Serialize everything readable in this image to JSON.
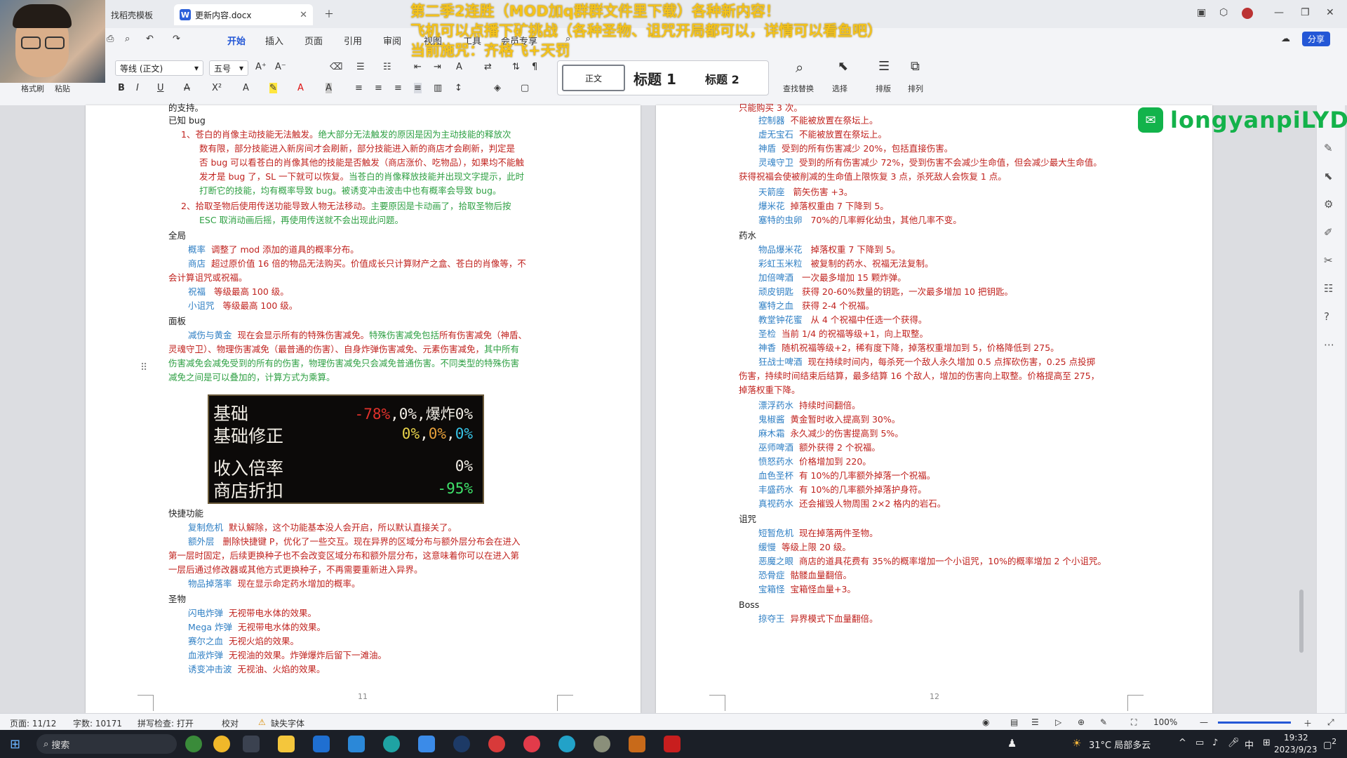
{
  "window": {
    "tabs": [
      {
        "label": "找稻壳模板"
      },
      {
        "label": "更新内容.docx"
      }
    ]
  },
  "ribbon": {
    "tabs": [
      "开始",
      "插入",
      "页面",
      "引用",
      "审阅",
      "视图",
      "工具",
      "会员专享"
    ],
    "share": "分享",
    "format_painter": "格式刷",
    "paste": "粘贴",
    "font": "等线 (正文)",
    "size": "五号",
    "style_normal": "正文",
    "style_h1": "标题 1",
    "style_h2": "标题 2",
    "find_replace": "查找替换",
    "select": "选择",
    "layout": "排版",
    "arrange": "排列"
  },
  "overlay": {
    "line1": "第二季2连胜（MOD加q群群文件里下载）各种新内容！",
    "line2": "飞机可以点播下矿挑战（各种圣物、诅咒开局都可以，详情可以看鱼吧）",
    "line3": "当前施咒：齐格飞+天罚"
  },
  "watermark": "longyanpiLYD",
  "left_page": {
    "lines": [
      "的支持。",
      "已知 bug",
      "1、苍白的肖像主动技能无法触发。",
      "绝大部分无法触发的原因是因为主动技能的释放次",
      "数有限，部分技能进入新房间才会刷新，部分技能进入新的商店才会刷新，判定是",
      "否 bug 可以看苍白的肖像其他的技能是否触发（商店涨价、吃物品），如果均不能触",
      "发才是 bug 了，SL 一下就可以恢复。",
      "当苍白的肖像释放技能并出现文字提示，此时",
      "打断它的技能，均有概率导致 bug。被诱变冲击波击中也有概率会导致 bug。",
      "2、拾取圣物后使用传送功能导致人物无法移动。",
      "主要原因是卡动画了，拾取圣物后按",
      "ESC 取消动画后摇，再使用传送就不会出现此问题。",
      "全局",
      "概率",
      "调整了 mod 添加的道具的概率分布。",
      "商店",
      "超过原价值 16 倍的物品无法购买。价值成长只计算财产之盒、苍白的肖像等，不",
      "会计算诅咒或祝福。",
      "祝福",
      "等级最高 100 级。",
      "小诅咒",
      "等级最高 100 级。",
      "面板",
      "减伤与黄金",
      "现在会显示所有的特殊伤害减免。",
      "特殊伤害减免包括",
      "所有伤害减免（神盾、",
      "灵魂守卫）、物理伤害减免（最普通的伤害）、自身炸弹伤害减免、元素伤害减免，",
      "其中所有",
      "伤害减免会减免受到的所有的伤害，物理伤害减免只会减免普通伤害。不同类型的特殊伤害",
      "减免之间是可以叠加的，计算方式为乘算。",
      "快捷功能",
      "复制危机",
      "默认解除，这个功能基本没人会开启，所以默认直接关了。",
      "额外层",
      "删除快捷键 P，优化了一些交互。现在异界的区域分布与额外层分布会在进入",
      "第一层时固定，后续更换种子也不会改变区域分布和额外层分布，这意味着你可以在进入第",
      "一层后通过修改器或其他方式更换种子，不再需要重新进入异界。",
      "物品掉落率",
      "现在显示命定药水增加的概率。",
      "圣物",
      "闪电炸弹",
      "无视带电水体的效果。",
      "Mega 炸弹",
      "无视带电水体的效果。",
      "赛尔之血",
      "无视火焰的效果。",
      "血液炸弹",
      "无视油的效果。炸弹爆炸后留下一滩油。",
      "诱变冲击波",
      "无视油、火焰的效果。"
    ],
    "page_number": "11"
  },
  "game_panel": {
    "rows": [
      {
        "label": "基础",
        "vals": [
          "-78%",
          ",0%,",
          "爆炸0%"
        ]
      },
      {
        "label": "基础修正",
        "vals": [
          "0%",
          ",",
          "0%",
          ",",
          "0%"
        ]
      },
      {
        "label": "收入倍率",
        "vals": [
          "0%"
        ]
      },
      {
        "label": "商店折扣",
        "vals": [
          "-95%"
        ]
      }
    ]
  },
  "right_page": {
    "lines": [
      "只能购买 3 次。",
      "控制器",
      "不能被放置在祭坛上。",
      "虚无宝石",
      "不能被放置在祭坛上。",
      "神盾",
      "受到的所有伤害减少 20%，包括直接伤害。",
      "灵魂守卫",
      "受到的所有伤害减少 72%，受到伤害不会减少生命值，但会减少最大生命值。",
      "获得祝福会使被削减的生命值上限恢复 3 点，杀死敌人会恢复 1 点。",
      "天箭座",
      "箭矢伤害 +3。",
      "爆米花",
      "掉落权重由 7 下降到 5。",
      "塞特的虫卵",
      "70%的几率孵化幼虫，其他几率不变。",
      "药水",
      "物品爆米花",
      "掉落权重 7 下降到 5。",
      "彩虹玉米粒",
      "被复制的药水、祝福无法复制。",
      "加倍啤酒",
      "一次最多增加 15 颗炸弹。",
      "顽皮钥匙",
      "获得 20-60%数量的钥匙，一次最多增加 10 把钥匙。",
      "塞特之血",
      "获得 2-4 个祝福。",
      "教堂钟花蜜",
      "从 4 个祝福中任选一个获得。",
      "圣检",
      "当前 1/4 的祝福等级+1，向上取整。",
      "神香",
      "随机祝福等级+2，稀有度下降，掉落权重增加到 5，价格降低到 275。",
      "狂战士啤酒",
      "现在持续时间内，每杀死一个敌人永久增加 0.5 点挥砍伤害，0.25 点投掷",
      "伤害，持续时间结束后结算，最多结算 16 个敌人，增加的伤害向上取整。价格提高至 275，",
      "掉落权重下降。",
      "漂浮药水",
      "持续时间翻倍。",
      "鬼椒酱",
      "黄金暂时收入提高到 30%。",
      "麻木霜",
      "永久减少的伤害提高到 5%。",
      "巫师啤酒",
      "额外获得 2 个祝福。",
      "愤怒药水",
      "价格增加到 220。",
      "血色圣杯",
      "有 10%的几率额外掉落一个祝福。",
      "丰盛药水",
      "有 10%的几率额外掉落护身符。",
      "真视药水",
      "还会摧毁人物周围 2×2 格内的岩石。",
      "诅咒",
      "短暂危机",
      "现在掉落两件圣物。",
      "缓慢",
      "等级上限 20 级。",
      "恶魔之眼",
      "商店的道具花费有 35%的概率增加一个小诅咒，10%的概率增加 2 个小诅咒。",
      "恐骨症",
      "骷髅血量翻倍。",
      "宝箱怪",
      "宝箱怪血量+3。",
      "Boss",
      "掠夺王",
      "异界模式下血量翻倍。"
    ],
    "page_number": "12"
  },
  "status": {
    "page": "页面: 11/12",
    "words": "字数: 10171",
    "spell": "拼写检查: 打开",
    "proof": "校对",
    "missing_font": "缺失字体",
    "zoom": "100%"
  },
  "taskbar": {
    "search": "搜索",
    "weather": "31°C 局部多云",
    "ime": "中",
    "time": "19:32",
    "date": "2023/9/23",
    "notif": "2"
  },
  "colors": {
    "accent": "#2457d6",
    "term_blue": "#2f7fc4",
    "red": "#c0221e",
    "green": "#2ea043",
    "overlay_yellow": "#f4c21b",
    "game_red": "#e0312b",
    "game_yellow": "#e8d34a",
    "game_cyan": "#38c3e6",
    "game_green": "#3fe36b"
  }
}
